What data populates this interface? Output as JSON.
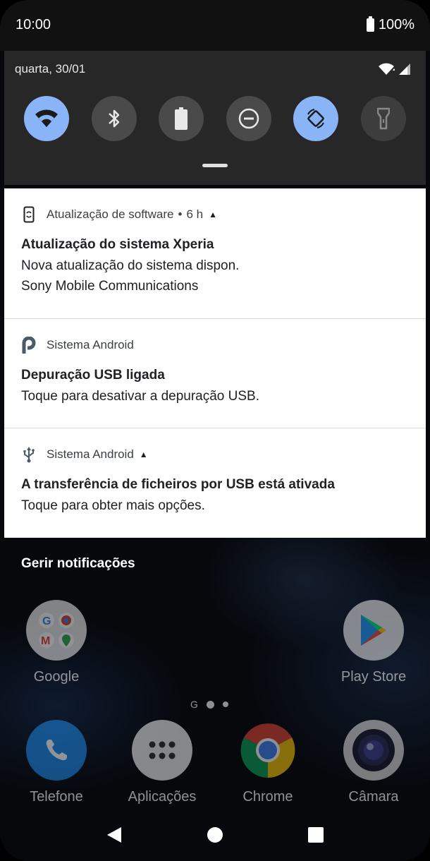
{
  "status_bar": {
    "time": "10:00",
    "battery": "100%"
  },
  "quick_settings": {
    "date": "quarta, 30/01",
    "tiles": [
      {
        "name": "wifi",
        "on": true
      },
      {
        "name": "bluetooth",
        "on": false
      },
      {
        "name": "battery-saver",
        "on": false
      },
      {
        "name": "do-not-disturb",
        "on": false
      },
      {
        "name": "auto-rotate",
        "on": true
      },
      {
        "name": "flashlight",
        "on": false
      }
    ],
    "accent_color": "#8ab4f8"
  },
  "notifications": [
    {
      "app": "Atualização de software",
      "separator": "•",
      "time": "6 h",
      "title": "Atualização do sistema Xperia",
      "text1": "Nova atualização do sistema dispon.",
      "text2": "Sony Mobile Communications"
    },
    {
      "app": "Sistema Android",
      "title": "Depuração USB ligada",
      "text1": "Toque para desativar a depuração USB."
    },
    {
      "app": "Sistema Android",
      "title": "A transferência de ficheiros por USB está ativada",
      "text1": "Toque para obter mais opções."
    }
  ],
  "manage_notifications": "Gerir notificações",
  "home": {
    "apps_row1": [
      {
        "label": "Google",
        "icon": "google-folder-icon"
      },
      {
        "label": "Play Store",
        "icon": "play-store-icon"
      }
    ],
    "page_indicator_g": "G",
    "dock": [
      {
        "label": "Telefone",
        "icon": "phone-icon"
      },
      {
        "label": "Aplicações",
        "icon": "app-drawer-icon"
      },
      {
        "label": "Chrome",
        "icon": "chrome-icon"
      },
      {
        "label": "Câmara",
        "icon": "camera-icon"
      }
    ]
  }
}
